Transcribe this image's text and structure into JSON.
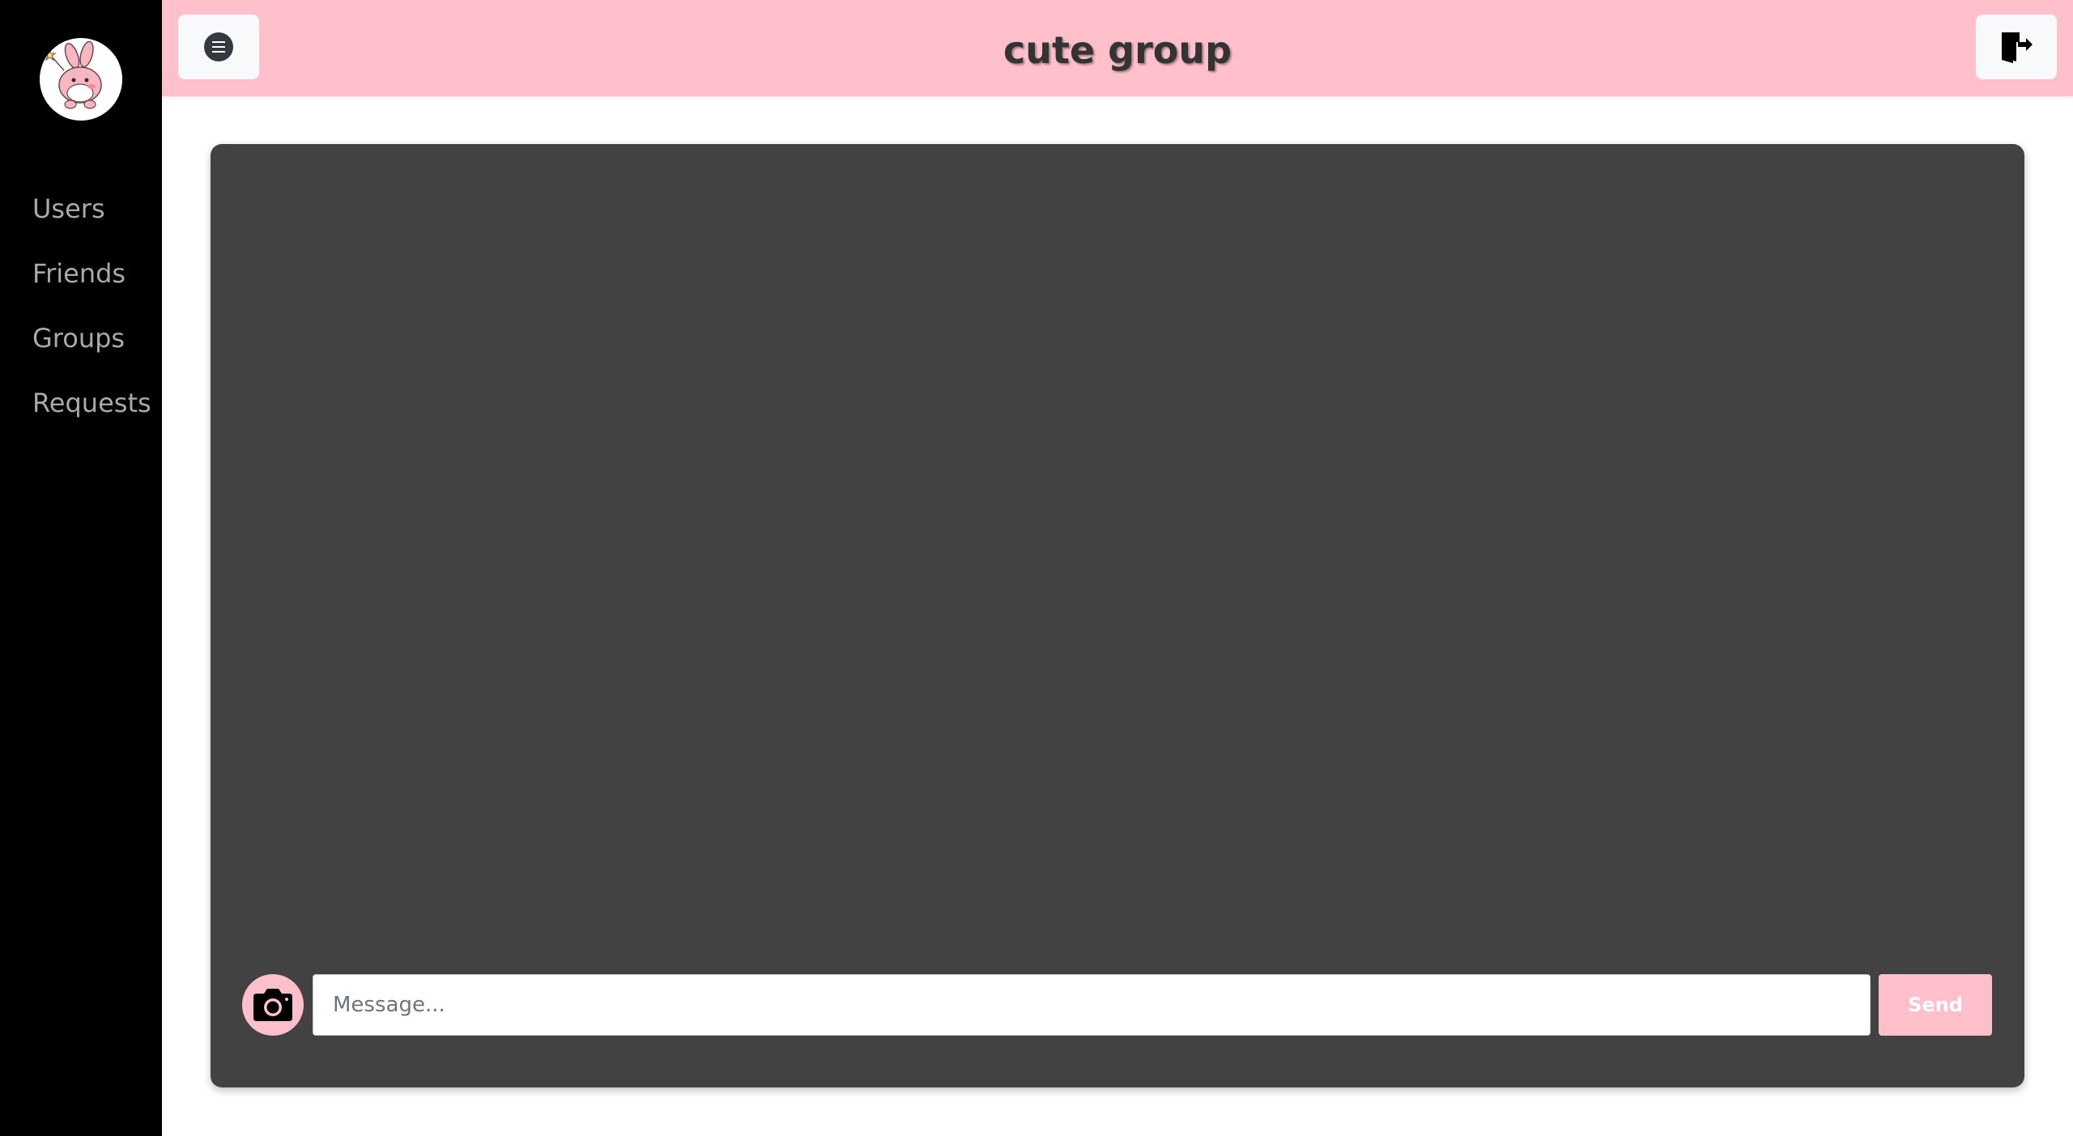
{
  "header": {
    "title": "cute group",
    "menu_icon": "hamburger-menu-icon",
    "logout_icon": "door-exit-icon"
  },
  "sidebar": {
    "avatar_icon": "bunny-avatar",
    "items": [
      {
        "label": "Users"
      },
      {
        "label": "Friends"
      },
      {
        "label": "Groups"
      },
      {
        "label": "Requests"
      }
    ]
  },
  "chat": {
    "camera_icon": "camera-icon",
    "message_placeholder": "Message...",
    "message_value": "",
    "send_label": "Send"
  },
  "colors": {
    "accent": "#ffc0cb",
    "sidebar_bg": "#000000",
    "panel_bg": "#424242",
    "nav_text": "#a9a9a9"
  }
}
